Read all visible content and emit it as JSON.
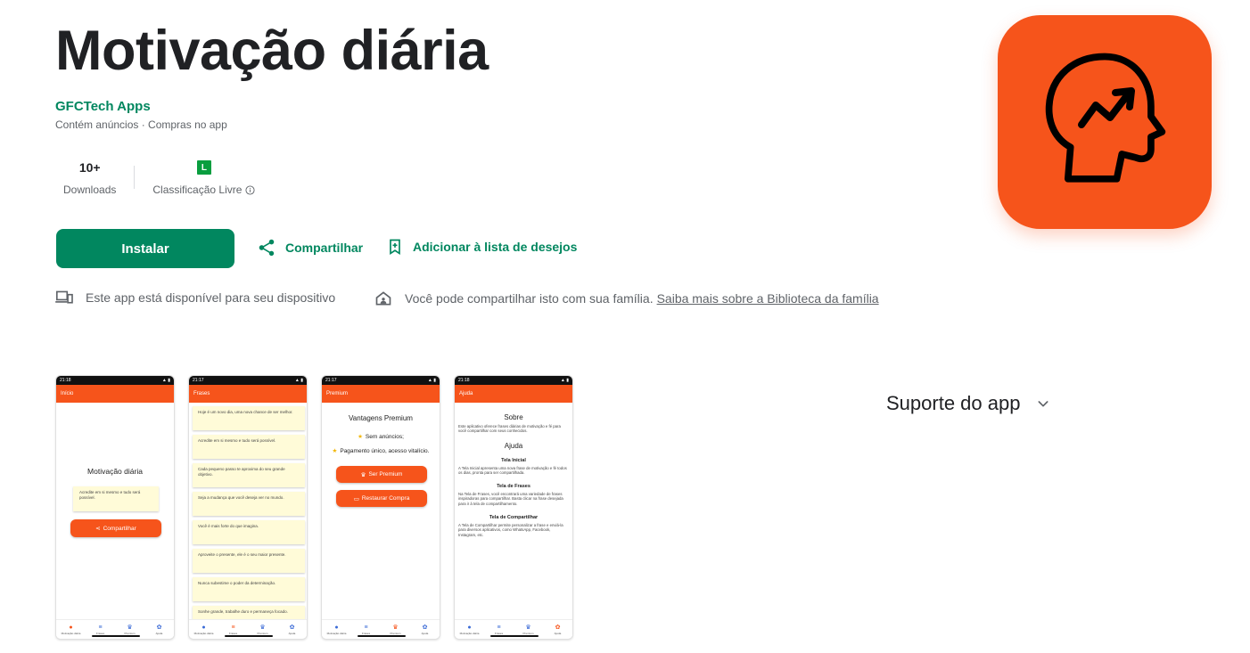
{
  "app": {
    "title": "Motivação diária",
    "developer": "GFCTech Apps",
    "ad_info": "Contém anúncios · Compras no app"
  },
  "stats": {
    "downloads_value": "10+",
    "downloads_label": "Downloads",
    "rating_badge": "L",
    "rating_label": "Classificação Livre"
  },
  "actions": {
    "install": "Instalar",
    "share": "Compartilhar",
    "wishlist": "Adicionar à lista de desejos"
  },
  "availability": {
    "device": "Este app está disponível para seu dispositivo",
    "family": "Você pode compartilhar isto com sua família.",
    "family_link": "Saiba mais sobre a Biblioteca da família"
  },
  "support": {
    "label": "Suporte do app"
  },
  "colors": {
    "accent": "#01875f",
    "app_orange": "#f6541b",
    "rating_green": "#0a9e3f"
  },
  "icons": [
    "share-icon",
    "bookmark-add-icon",
    "devices-icon",
    "family-home-icon",
    "chevron-down-icon",
    "head-growth-icon"
  ],
  "screenshots": {
    "nav": {
      "home": "Motivação diária",
      "phrases": "Frases",
      "premium": "Premium",
      "help": "Ajuda"
    },
    "s1": {
      "time": "21:18",
      "title": "Início",
      "heading": "Motivação diária",
      "card": "Acredite em si mesmo e tudo será possível.",
      "button": "Compartilhar"
    },
    "s2": {
      "time": "21:17",
      "title": "Frases",
      "phrases": [
        "Hoje é um novo dia, uma nova chance de ser melhor.",
        "Acredite em si mesmo e tudo será possível.",
        "Cada pequeno passo te aproxima do seu grande objetivo.",
        "Seja a mudança que você deseja ver no mundo.",
        "Você é mais forte do que imagina.",
        "Aproveite o presente, ele é o seu maior presente.",
        "Nunca subestime o poder da determinação.",
        "Sonhe grande, trabalhe duro e permaneça focado."
      ]
    },
    "s3": {
      "time": "21:17",
      "title": "Premium",
      "heading": "Vantagens Premium",
      "benefit1": "Sem anúncios;",
      "benefit2": "Pagamento único, acesso vitalício.",
      "button1": "Ser Premium",
      "button2": "Restaurar Compra"
    },
    "s4": {
      "time": "21:18",
      "title": "Ajuda",
      "about_heading": "Sobre",
      "about_text": "Este aplicativo oferece frases diárias de motivação e fé para você compartilhar com seus conhecidos.",
      "help_heading": "Ajuda",
      "sec1_title": "Tela Inicial",
      "sec1_text": "A Tela Inicial apresenta uma nova frase de motivação e fé todos os dias, pronta para ser compartilhada.",
      "sec2_title": "Tela de Frases",
      "sec2_text": "Na Tela de Frases, você encontrará uma variedade de frases inspiradoras para compartilhar. Basta clicar na frase desejada para ir à tela de compartilhamento.",
      "sec3_title": "Tela de Compartilhar",
      "sec3_text": "A Tela de Compartilhar permite personalizar a frase e enviá-la para diversos aplicativos, como WhatsApp, Facebook, Instagram, etc."
    }
  }
}
